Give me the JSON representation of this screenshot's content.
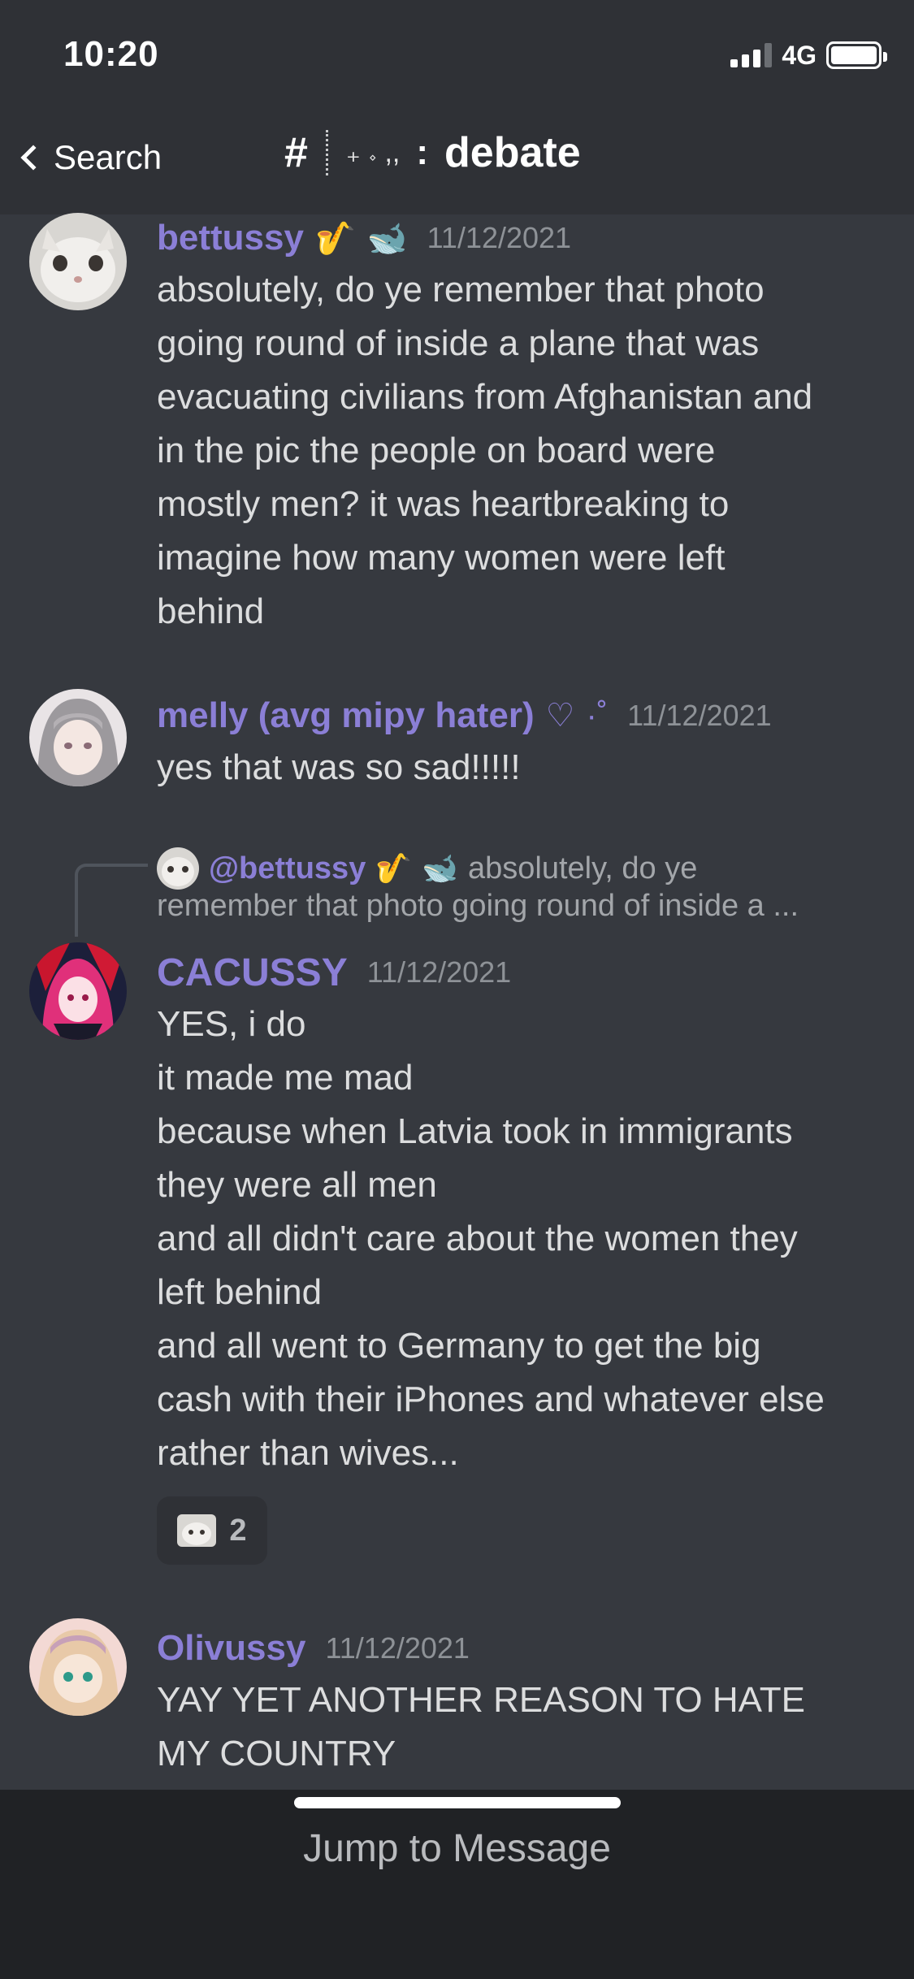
{
  "status_bar": {
    "time": "10:20",
    "network": "4G"
  },
  "nav": {
    "back_label": "Search",
    "hash": "#",
    "decoration": "₊ 𝆹 ,,",
    "colon": ":",
    "channel_name": "debate"
  },
  "messages": [
    {
      "username": "bettussy",
      "badges": [
        "🎷",
        "🐋"
      ],
      "timestamp": "11/12/2021",
      "text": "absolutely, do ye remember that photo\ngoing round of inside a plane that was\nevacuating civilians from Afghanistan and\nin the pic the people on board were\nmostly men? it was heartbreaking to\nimagine how many women were left\nbehind"
    },
    {
      "username": "melly (avg mipy hater)",
      "badges": [
        "♡",
        "·˚"
      ],
      "timestamp": "11/12/2021",
      "text": "yes that was so sad!!!!!"
    },
    {
      "reply": {
        "mention": "@bettussy",
        "badges": [
          "🎷",
          "🐋"
        ],
        "preview_line1": "absolutely, do ye",
        "preview_line2": "remember that photo going round of inside a ..."
      },
      "username": "CACUSSY",
      "timestamp": "11/12/2021",
      "text": "YES, i do\nit made me mad\nbecause when Latvia took in immigrants\nthey were all men\nand all didn't care about the women they\nleft behind\nand all went to Germany to get the big\ncash with their iPhones and whatever else\nrather than wives...",
      "reaction": {
        "count": "2"
      }
    },
    {
      "username": "Olivussy",
      "timestamp": "11/12/2021",
      "text": "YAY YET ANOTHER REASON TO HATE\nMY COUNTRY"
    }
  ],
  "bottom_bar": {
    "jump_label": "Jump to Message"
  },
  "colors": {
    "background": "#36393f",
    "header": "#2f3136",
    "username": "#8b7fd6",
    "bottom_bar": "#202225"
  }
}
